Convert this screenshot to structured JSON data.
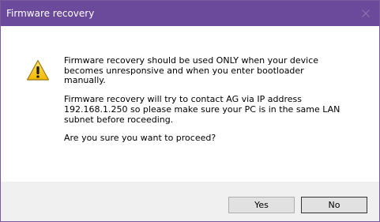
{
  "window": {
    "title": "Firmware recovery",
    "titlebar_color": "#6b4a9b",
    "close_icon": "close-icon"
  },
  "message": {
    "icon": "warning-icon",
    "paragraphs": [
      "Firmware recovery should be used ONLY when your device\nbecomes unresponsive and when you enter bootloader\nmanually.",
      "Firmware recovery will try to contact AG via IP address\n192.168.1.250 so please make sure your PC is in the same LAN\nsubnet before roceeding.",
      "Are you sure you want to proceed?"
    ]
  },
  "buttons": {
    "yes_label": "Yes",
    "no_label": "No"
  }
}
